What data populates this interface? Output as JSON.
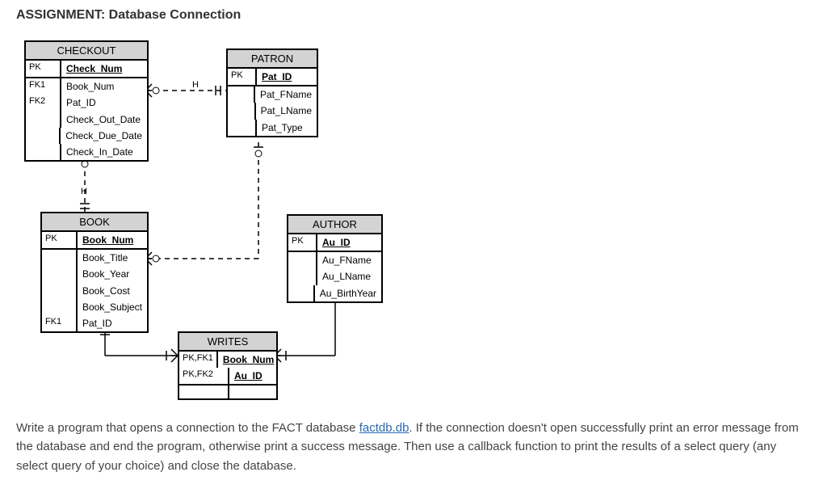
{
  "title": "ASSIGNMENT: Database Connection",
  "entities": {
    "checkout": {
      "name": "CHECKOUT",
      "pk_label": "PK",
      "pk_field": "Check_Num",
      "fk1_label": "FK1",
      "fk1_field": "Book_Num",
      "fk2_label": "FK2",
      "fk2_field": "Pat_ID",
      "attr1": "Check_Out_Date",
      "attr2": "Check_Due_Date",
      "attr3": "Check_In_Date"
    },
    "patron": {
      "name": "PATRON",
      "pk_label": "PK",
      "pk_field": "Pat_ID",
      "attr1": "Pat_FName",
      "attr2": "Pat_LName",
      "attr3": "Pat_Type"
    },
    "book": {
      "name": "BOOK",
      "pk_label": "PK",
      "pk_field": "Book_Num",
      "attr1": "Book_Title",
      "attr2": "Book_Year",
      "attr3": "Book_Cost",
      "attr4": "Book_Subject",
      "fk1_label": "FK1",
      "fk1_field": "Pat_ID"
    },
    "author": {
      "name": "AUTHOR",
      "pk_label": "PK",
      "pk_field": "Au_ID",
      "attr1": "Au_FName",
      "attr2": "Au_LName",
      "attr3": "Au_BirthYear"
    },
    "writes": {
      "name": "WRITES",
      "pk1_label": "PK,FK1",
      "pk1_field": "Book_Num",
      "pk2_label": "PK,FK2",
      "pk2_field": "Au_ID"
    }
  },
  "instructions": {
    "text_before": "Write a program that opens a connection to the FACT database ",
    "link_text": "factdb.db",
    "text_after": ". If the connection doesn't open successfully print an error message from the database and end the program, otherwise print a success message. Then use a callback function to print the results of a select query (any select query of your choice) and close the database."
  }
}
